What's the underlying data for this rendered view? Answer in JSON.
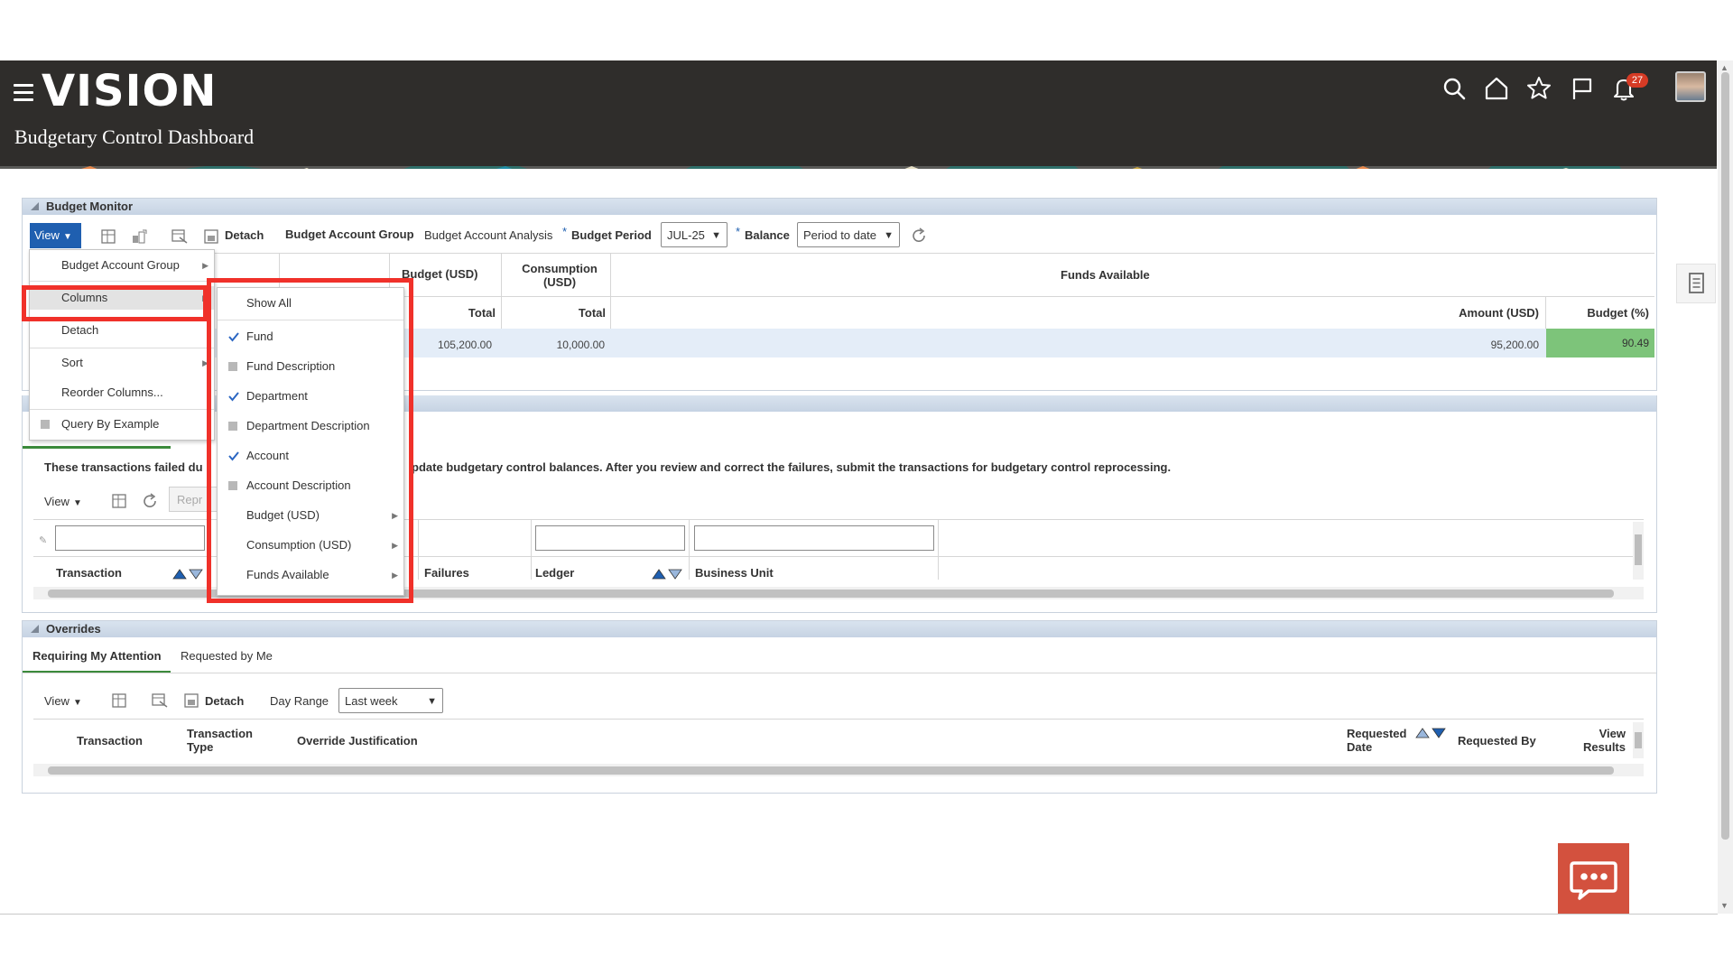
{
  "header": {
    "brand": "VISION",
    "title": "Budgetary Control Dashboard",
    "notification_count": "27"
  },
  "colors": {
    "header_bg": "#2f2d2b",
    "accent_blue": "#1f5fb0",
    "highlight_red": "#f0312a",
    "chat_bg": "#d3513e",
    "percent_green": "#7dc47a"
  },
  "budget_monitor": {
    "title": "Budget Monitor",
    "toolbar": {
      "view": "View",
      "detach": "Detach",
      "budget_account_group": "Budget Account Group",
      "budget_account_analysis": "Budget Account Analysis",
      "required_mark": "*",
      "budget_period_label": "Budget Period",
      "budget_period_value": "JUL-25",
      "balance_label": "Balance",
      "balance_value": "Period to date"
    },
    "columns": {
      "budget_usd": "Budget (USD)",
      "consumption_usd": "Consumption (USD)",
      "funds_available": "Funds Available",
      "total": "Total",
      "amount_usd": "Amount (USD)",
      "budget_pct": "Budget (%)"
    },
    "row": {
      "budget_total": "105,200.00",
      "consumption_total": "10,000.00",
      "amount": "95,200.00",
      "percent": "90.49"
    }
  },
  "view_menu": {
    "items": [
      {
        "label": "Budget Account Group",
        "submenu": true
      },
      {
        "label": "Columns",
        "submenu": true
      },
      {
        "label": "Detach",
        "submenu": false
      },
      {
        "label": "Sort",
        "submenu": true
      },
      {
        "label": "Reorder Columns...",
        "submenu": false
      },
      {
        "label": "Query By Example",
        "submenu": false
      }
    ]
  },
  "columns_menu": {
    "items": [
      {
        "label": "Show All",
        "state": "none"
      },
      {
        "label": "Fund",
        "state": "checked"
      },
      {
        "label": "Fund Description",
        "state": "unchecked"
      },
      {
        "label": "Department",
        "state": "checked"
      },
      {
        "label": "Department Description",
        "state": "unchecked"
      },
      {
        "label": "Account",
        "state": "checked"
      },
      {
        "label": "Account Description",
        "state": "unchecked"
      },
      {
        "label": "Budget (USD)",
        "state": "submenu"
      },
      {
        "label": "Consumption (USD)",
        "state": "submenu"
      },
      {
        "label": "Funds Available",
        "state": "submenu"
      }
    ]
  },
  "failures": {
    "message_left": "These transactions failed du",
    "message_right": "pdate budgetary control balances. After you review and correct the failures, submit the transactions for budgetary control reprocessing.",
    "view": "View",
    "reprocess": "Repr",
    "columns": {
      "transaction": "Transaction",
      "failures": "Failures",
      "ledger": "Ledger",
      "business_unit": "Business Unit"
    }
  },
  "overrides": {
    "title": "Overrides",
    "tabs": [
      "Requiring My Attention",
      "Requested by Me"
    ],
    "view": "View",
    "detach": "Detach",
    "day_range_label": "Day Range",
    "day_range_value": "Last week",
    "columns": {
      "transaction": "Transaction",
      "transaction_type": "Transaction Type",
      "override_justification": "Override Justification",
      "requested_date": "Requested Date",
      "requested_by": "Requested By",
      "view_results": "View Results"
    }
  }
}
